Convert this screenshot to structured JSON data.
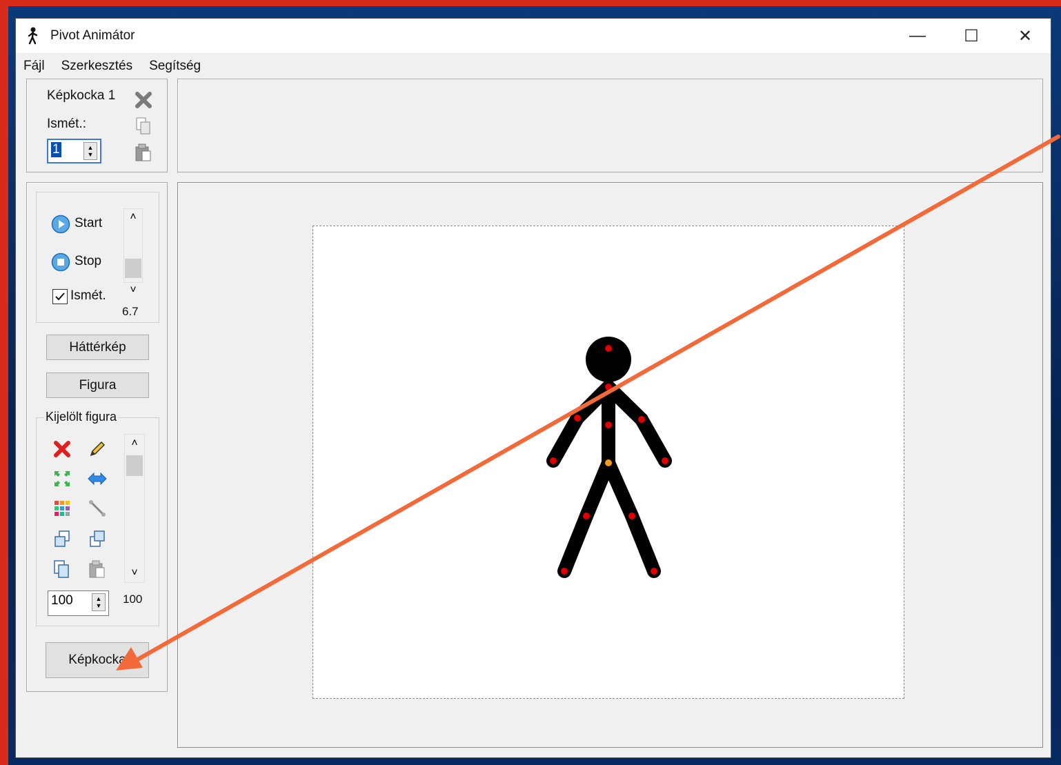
{
  "window": {
    "title": "Pivot Animátor",
    "min_glyph": "—",
    "max_glyph": "☐",
    "close_glyph": "✕"
  },
  "menu": [
    "Fájl",
    "Szerkesztés",
    "Segítség"
  ],
  "frame_panel": {
    "frame_label": "Képkocka 1",
    "repeat_label": "Ismét.:",
    "repeat_value": "1"
  },
  "playback": {
    "start_label": "Start",
    "stop_label": "Stop",
    "loop_label": "Ismét.",
    "loop_checked": true,
    "speed_value": "6.7"
  },
  "buttons": {
    "background_label": "Háttérkép",
    "figure_label": "Figura",
    "frame_add_label": "Képkocka"
  },
  "selected_figure": {
    "group_label": "Kijelölt figura",
    "scale_value": "100",
    "scale_slider_value": "100"
  },
  "icons": {
    "delete_frame": "close-x-gray-icon",
    "copy_frame": "copy-icon",
    "paste_frame": "paste-icon",
    "delete_figure": "red-x-icon",
    "edit_figure": "pencil-icon",
    "shrink": "shrink-icon",
    "flip": "flip-arrow-icon",
    "color": "color-palette-icon",
    "line": "line-tool-icon",
    "bring_front": "bring-front-icon",
    "send_back": "send-back-icon",
    "copy_figure": "copy-icon",
    "paste_figure": "paste-icon"
  },
  "colors": {
    "accent_arrow": "#f26a3a",
    "frame_red": "#d92b1c",
    "joint_red": "#e00000",
    "joint_orange": "#f39c12"
  }
}
